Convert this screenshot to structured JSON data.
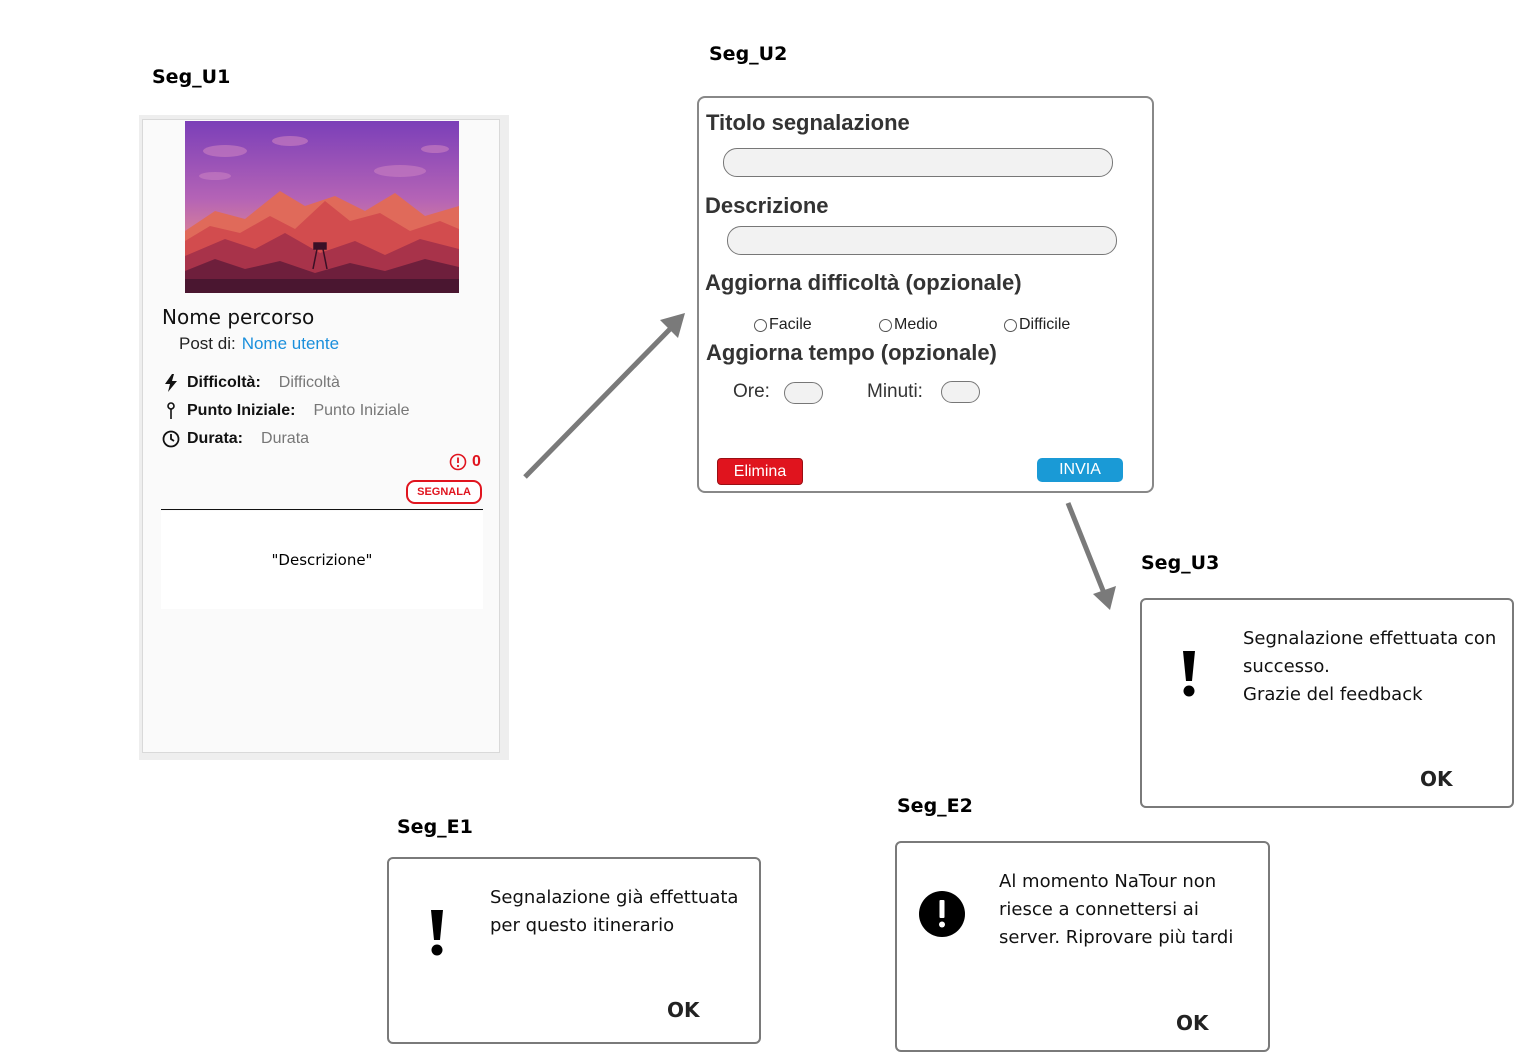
{
  "screens": {
    "u1": "Seg_U1",
    "u2": "Seg_U2",
    "u3": "Seg_U3",
    "e1": "Seg_E1",
    "e2": "Seg_E2"
  },
  "route_card": {
    "image": "mountain-sunset-illustration",
    "title": "Nome percorso",
    "post_by_label": "Post di:",
    "post_by_user": "Nome utente",
    "difficulty_label": "Difficoltà:",
    "difficulty_value": "Difficoltà",
    "start_label": "Punto Iniziale:",
    "start_value": "Punto Iniziale",
    "duration_label": "Durata:",
    "duration_value": "Durata",
    "report_count": "0",
    "report_button": "SEGNALA",
    "description": "\"Descrizione\"",
    "colors": {
      "accent_red": "#e0141e",
      "link_blue": "#1a8fdc"
    }
  },
  "report_form": {
    "title_label": "Titolo segnalazione",
    "description_label": "Descrizione",
    "difficulty_label": "Aggiorna difficoltà (opzionale)",
    "difficulty_options": [
      "Facile",
      "Medio",
      "Difficile"
    ],
    "time_label": "Aggiorna tempo (opzionale)",
    "hours_label": "Ore:",
    "minutes_label": "Minuti:",
    "delete_button": "Elimina",
    "send_button": "INVIA",
    "colors": {
      "delete": "#e0141e",
      "send": "#1a9ad6"
    }
  },
  "dialog_success": {
    "icon": "exclamation-icon",
    "message": "Segnalazione effettuata con\nsuccesso.\nGrazie del feedback",
    "ok": "OK"
  },
  "dialog_already": {
    "icon": "exclamation-icon",
    "message": "Segnalazione già effettuata\nper questo itinerario",
    "ok": "OK"
  },
  "dialog_server": {
    "icon": "exclamation-circle-icon",
    "message": "Al momento NaTour non\nriesce a connettersi ai\nserver. Riprovare più tardi",
    "ok": "OK"
  }
}
